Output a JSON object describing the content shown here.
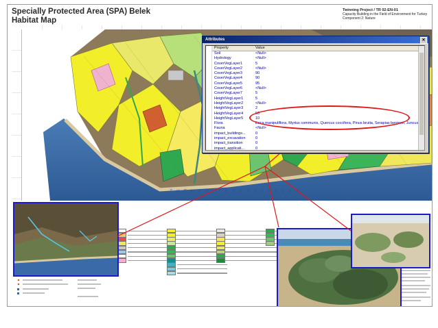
{
  "header": {
    "title_line1": "Specially Protected Area (SPA) Belek",
    "title_line2": "Habitat Map",
    "project": "Twinning Project / TR 02-EN-01",
    "subtitle1": "Capacity Building in the Field of Environment for Turkey",
    "subtitle2": "Component 2: Nature"
  },
  "map": {
    "sea_label": "T H E   M E D I T E R R A N E A N   S E A"
  },
  "attributes_window": {
    "title": "Attributes",
    "close_glyph": "✕",
    "col_property": "Property",
    "col_value": "Value",
    "rows": [
      {
        "property": "Soil",
        "value": "<Null>"
      },
      {
        "property": "Hydrology",
        "value": "<Null>"
      },
      {
        "property": "CoverVegLayer1",
        "value": "5"
      },
      {
        "property": "CoverVegLayer2",
        "value": "<Null>"
      },
      {
        "property": "CoverVegLayer3",
        "value": "90"
      },
      {
        "property": "CoverVegLayer4",
        "value": "90"
      },
      {
        "property": "CoverVegLayer5",
        "value": "95"
      },
      {
        "property": "CoverVegLayer6",
        "value": "<Null>"
      },
      {
        "property": "CoverVegLayer7",
        "value": "5"
      },
      {
        "property": "HeightVegLayer1",
        "value": "5"
      },
      {
        "property": "HeightVegLayer2",
        "value": "<Null>"
      },
      {
        "property": "HeightVegLayer3",
        "value": "2"
      },
      {
        "property": "HeightVegLayer4",
        "value": "50"
      },
      {
        "property": "HeightVegLayer5",
        "value": "10"
      },
      {
        "property": "Flora",
        "value": "Erica manipuliflora, Myrtus communis, Quercus coccifera, Pinus brutia, Serapias bergonii, Juncus spec."
      },
      {
        "property": "Fauna",
        "value": "<Null>"
      },
      {
        "property": "impact_buildings...",
        "value": "0"
      },
      {
        "property": "impact_excavation",
        "value": "0"
      },
      {
        "property": "impact_transition",
        "value": "0"
      },
      {
        "property": "impact_applicati...",
        "value": "0"
      }
    ]
  },
  "colors": {
    "yellow_habitat": "#f2ee2a",
    "green_habitat": "#2fa84f",
    "pink_habitat": "#f0b2cf",
    "sea": "#3a6aa8",
    "highlight_red": "#e01818",
    "photo_border": "#1a1acc"
  }
}
